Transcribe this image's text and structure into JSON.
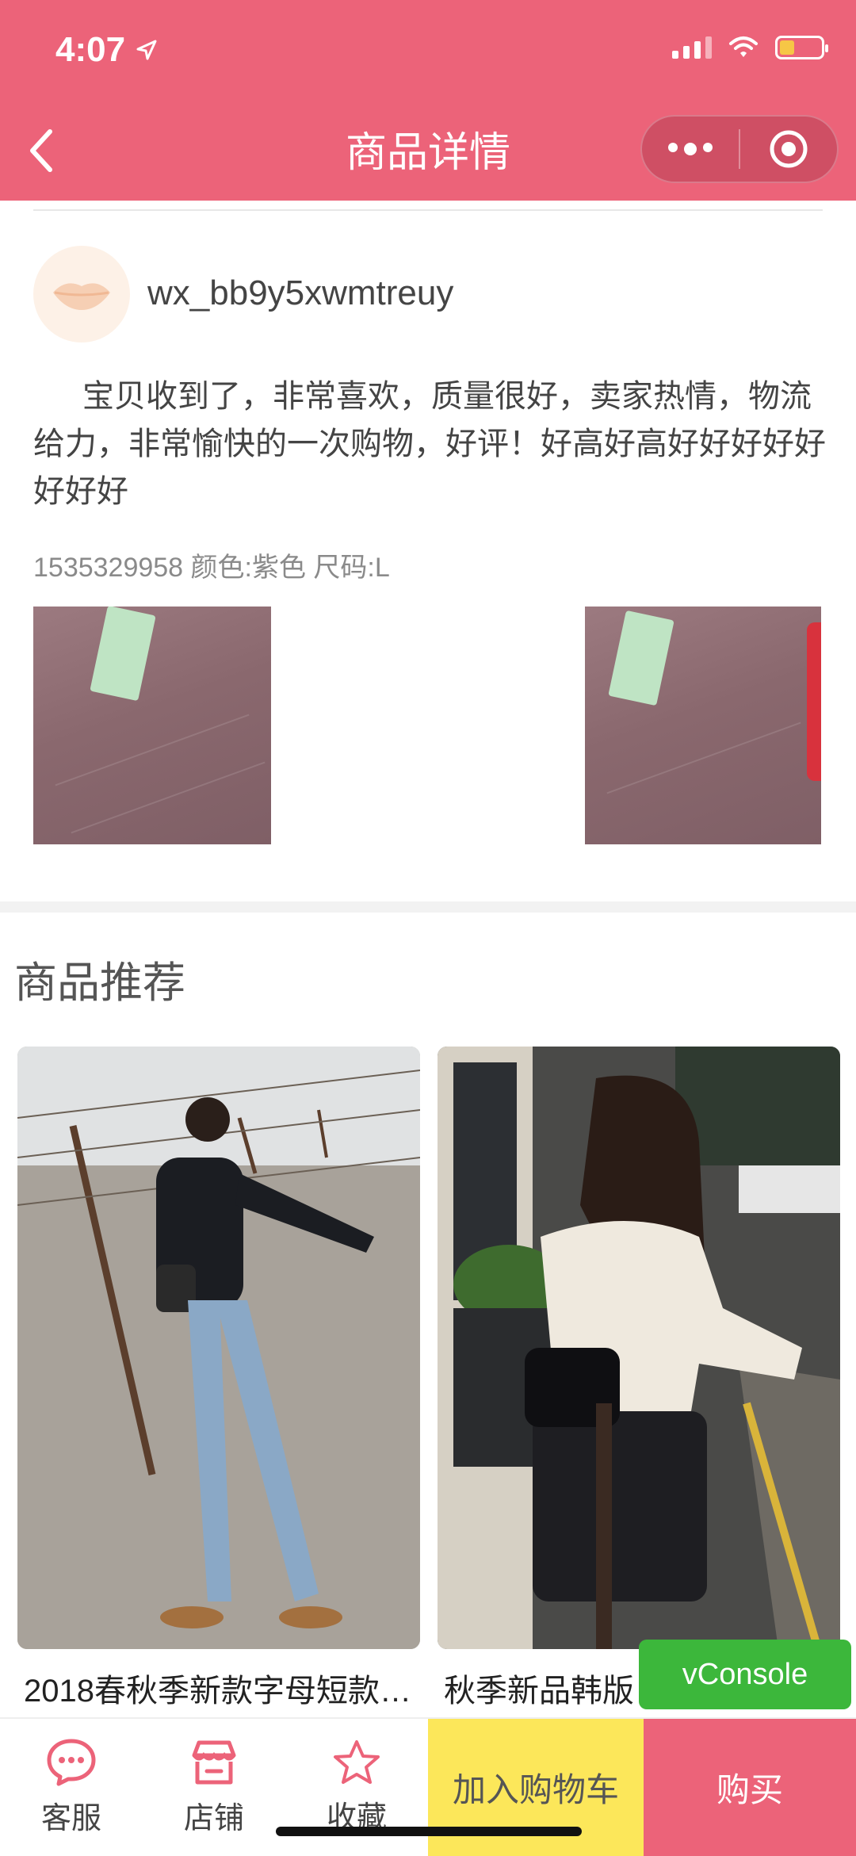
{
  "status_bar": {
    "time": "4:07"
  },
  "header": {
    "title": "商品详情"
  },
  "review": {
    "username": "wx_bb9y5xwmtreuy",
    "text": "宝贝收到了，非常喜欢，质量很好，卖家热情，物流给力，非常愉快的一次购物，好评！好高好高好好好好好好好好",
    "meta": "1535329958 颜色:紫色 尺码:L"
  },
  "recommend": {
    "title": "商品推荐",
    "products": [
      {
        "title": "2018春秋季新款字母短款…"
      },
      {
        "title": "秋季新品韩版"
      }
    ]
  },
  "vconsole": {
    "label": "vConsole"
  },
  "bottom_bar": {
    "service": "客服",
    "shop": "店铺",
    "favorite": "收藏",
    "add_cart": "加入购物车",
    "buy": "购买"
  },
  "colors": {
    "brand": "#ec6379",
    "cart": "#fce75a",
    "vconsole": "#3cb73b"
  }
}
